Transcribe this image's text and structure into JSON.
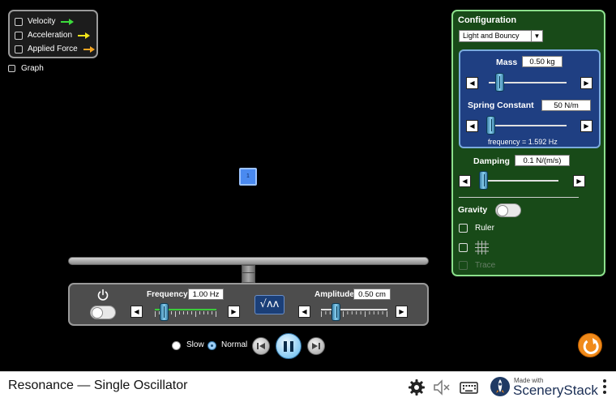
{
  "vectors": {
    "items": [
      {
        "label": "Velocity",
        "color": "#3cdc3c",
        "checked": false
      },
      {
        "label": "Acceleration",
        "color": "#f2e419",
        "checked": false
      },
      {
        "label": "Applied Force",
        "color": "#f5a623",
        "checked": false
      }
    ],
    "graph_label": "Graph",
    "graph_checked": false
  },
  "mass_block": {
    "label": "1"
  },
  "driver": {
    "frequency_label": "Frequency",
    "frequency_value": "1.00 Hz",
    "frequency_fraction": 0.15,
    "amplitude_label": "Amplitude",
    "amplitude_value": "0.50 cm",
    "amplitude_fraction": 0.23,
    "waveform_glyph": "√ᴧᴧ",
    "power_on": false
  },
  "time_controls": {
    "slow_label": "Slow",
    "normal_label": "Normal",
    "selected": "Normal"
  },
  "config": {
    "title": "Configuration",
    "dropdown_value": "Light and Bouncy",
    "mass_label": "Mass",
    "mass_value": "0.50 kg",
    "mass_fraction": 0.14,
    "spring_label": "Spring Constant",
    "spring_value": "50 N/m",
    "spring_fraction": 0.03,
    "frequency_text": "frequency = 1.592 Hz",
    "damping_label": "Damping",
    "damping_value": "0.1 N/(m/s)",
    "damping_fraction": 0.03,
    "gravity_label": "Gravity",
    "gravity_on": false,
    "ruler_label": "Ruler",
    "trace_label": "Trace"
  },
  "navbar": {
    "title": "Resonance — Single Oscillator",
    "brand_made": "Made with",
    "brand_name": "SceneryStack"
  },
  "colors": {
    "config_bg": "#184a18",
    "config_border": "#8ce08c",
    "subpanel_bg": "#1f3f82",
    "driver_bg": "#4d4d4d",
    "mass_block": "#4a8af0",
    "reset": "#f08a1a"
  }
}
